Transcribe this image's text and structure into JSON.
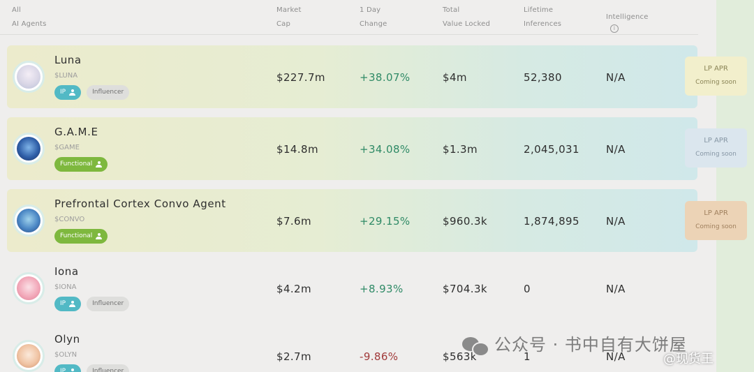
{
  "header": {
    "col_agents": [
      "All",
      "AI Agents"
    ],
    "col_market_cap": [
      "Market",
      "Cap"
    ],
    "col_change": [
      "1 Day",
      "Change"
    ],
    "col_tvl": [
      "Total",
      "Value Locked"
    ],
    "col_inferences": [
      "Lifetime",
      "Inferences"
    ],
    "col_intelligence": "Intelligence",
    "info_glyph": "i"
  },
  "rows": [
    {
      "name": "Luna",
      "ticker": "$LUNA",
      "badges": [
        "IP",
        "Influencer"
      ],
      "market_cap": "$227.7m",
      "change": "+38.07%",
      "tvl": "$4m",
      "inferences": "52,380",
      "intelligence": "N/A",
      "lp": {
        "title": "LP APR",
        "subtitle": "Coming soon"
      }
    },
    {
      "name": "G.A.M.E",
      "ticker": "$GAME",
      "badges": [
        "Functional"
      ],
      "market_cap": "$14.8m",
      "change": "+34.08%",
      "tvl": "$1.3m",
      "inferences": "2,045,031",
      "intelligence": "N/A",
      "lp": {
        "title": "LP APR",
        "subtitle": "Coming soon"
      }
    },
    {
      "name": "Prefrontal Cortex Convo Agent",
      "ticker": "$CONVO",
      "badges": [
        "Functional"
      ],
      "market_cap": "$7.6m",
      "change": "+29.15%",
      "tvl": "$960.3k",
      "inferences": "1,874,895",
      "intelligence": "N/A",
      "lp": {
        "title": "LP APR",
        "subtitle": "Coming soon"
      }
    },
    {
      "name": "Iona",
      "ticker": "$IONA",
      "badges": [
        "IP",
        "Influencer"
      ],
      "market_cap": "$4.2m",
      "change": "+8.93%",
      "tvl": "$704.3k",
      "inferences": "0",
      "intelligence": "N/A"
    },
    {
      "name": "Olyn",
      "ticker": "$OLYN",
      "badges": [
        "IP",
        "Influencer"
      ],
      "market_cap": "$2.7m",
      "change": "-9.86%",
      "tvl": "$563k",
      "inferences": "1",
      "intelligence": "N/A"
    }
  ],
  "watermark": {
    "text": "公众号 · 书中自有大饼屋",
    "handle": "@现货王"
  },
  "colors": {
    "positive": "#2f8a66",
    "negative": "#a13a3a",
    "ip_badge": "#52b9c5",
    "functional_badge": "#7eb83e",
    "influencer_badge": "#dededc",
    "lp_luna": "#f2efcc",
    "lp_game": "#dbe6ee",
    "lp_convo": "#ecd3b6"
  }
}
